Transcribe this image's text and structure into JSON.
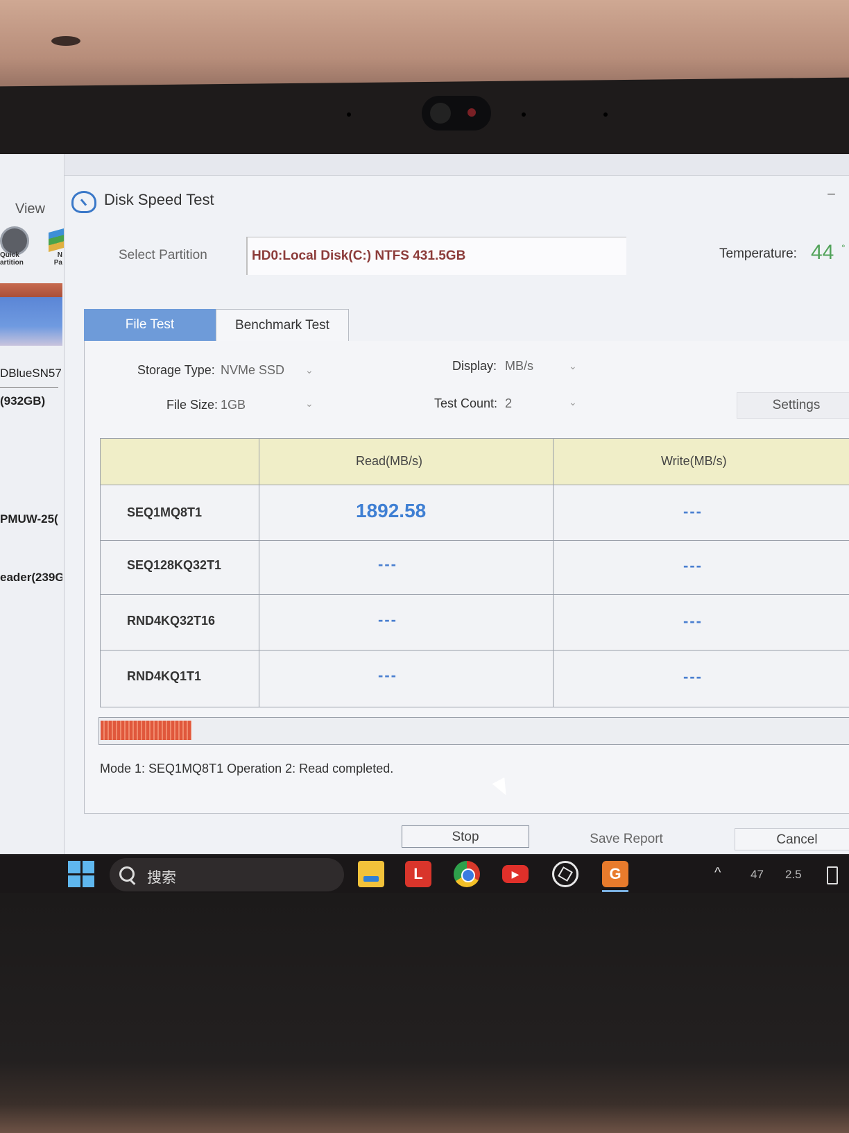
{
  "background_app": {
    "menu_view": "View",
    "icon1_label_line1": "Quick",
    "icon1_label_line2": "artition",
    "icon2_label_line1": "N",
    "icon2_label_line2": "Pa",
    "disk_name": "DBlueSN57",
    "disk_size": "(932GB)",
    "disk2_name": "PMUW-25(",
    "disk3_name": "eader(239G"
  },
  "dialog": {
    "title": "Disk Speed Test",
    "minimize": "−",
    "select_partition_label": "Select Partition",
    "partition_value": "HD0:Local Disk(C:) NTFS 431.5GB",
    "temperature_label": "Temperature:",
    "temperature_value": "44",
    "temperature_unit": "°",
    "tabs": {
      "file_test": "File Test",
      "benchmark_test": "Benchmark Test"
    },
    "options": {
      "storage_type_label": "Storage Type:",
      "storage_type_value": "NVMe SSD",
      "display_label": "Display:",
      "display_value": "MB/s",
      "file_size_label": "File Size:",
      "file_size_value": "1GB",
      "test_count_label": "Test Count:",
      "test_count_value": "2",
      "settings_label": "Settings"
    },
    "table": {
      "headers": [
        "",
        "Read(MB/s)",
        "Write(MB/s)"
      ],
      "rows": [
        {
          "name": "SEQ1MQ8T1",
          "read": "1892.58",
          "write": "---"
        },
        {
          "name": "SEQ128KQ32T1",
          "read": "---",
          "write": "---"
        },
        {
          "name": "RND4KQ32T16",
          "read": "---",
          "write": "---"
        },
        {
          "name": "RND4KQ1T1",
          "read": "---",
          "write": "---"
        }
      ]
    },
    "progress_fraction": 0.12,
    "status_text": "Mode 1: SEQ1MQ8T1 Operation 2: Read completed.",
    "buttons": {
      "stop": "Stop",
      "save_report": "Save Report",
      "cancel": "Cancel"
    }
  },
  "taskbar": {
    "search_text": "搜索",
    "apps": [
      "file-explorer",
      "l-app",
      "chrome",
      "youtube",
      "chatgpt",
      "disk-genius"
    ],
    "l_app_letter": "L",
    "tray_chevron": "^",
    "tray_num1": "47",
    "tray_num2": "2.5"
  }
}
